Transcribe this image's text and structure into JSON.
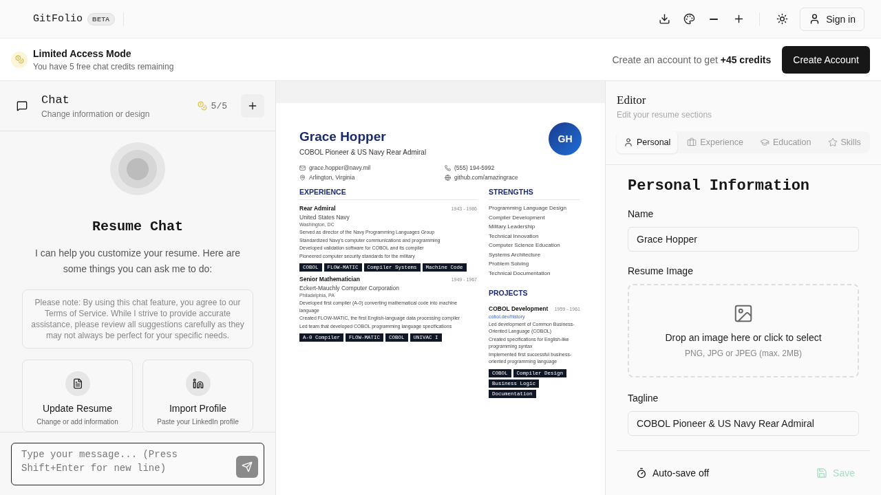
{
  "header": {
    "brand": "GitFolio",
    "badge": "BETA",
    "sign_in": "Sign in"
  },
  "banner": {
    "title": "Limited Access Mode",
    "subtitle": "You have 5 free chat credits remaining",
    "prompt": "Create an account to get **+45 credits**",
    "button": "Create Account"
  },
  "chat": {
    "title": "Chat",
    "subtitle": "Change information or design",
    "credits": "5/5",
    "heading": "Resume Chat",
    "intro": "I can help you customize your resume. Here are some things you can ask me to do:",
    "note": "Please note: By using this chat feature, you agree to our Terms of Service. While I strive to provide accurate assistance, please review all suggestions carefully as they may not always be perfect for your specific needs.",
    "actions": [
      {
        "kind": "document",
        "title": "Update Resume",
        "description": "Change or add information"
      },
      {
        "kind": "linkedin",
        "title": "Import Profile",
        "description": "Paste your LinkedIn profile"
      }
    ],
    "input": {
      "placeholder": "Type your message... (Press Shift+Enter for new line)"
    }
  },
  "resume": {
    "name": "Grace Hopper",
    "tagline": "COBOL Pioneer & US Navy Rear Admiral",
    "initials": "GH",
    "contacts": [
      {
        "kind": "email",
        "text": "grace.hopper@navy.mil"
      },
      {
        "kind": "phone",
        "text": "(555) 194-5992"
      },
      {
        "kind": "location",
        "text": "Arlington, Virginia"
      },
      {
        "kind": "web",
        "text": "github.com/amazingrace"
      }
    ],
    "experience": {
      "heading": "EXPERIENCE",
      "items": [
        {
          "title": "Rear Admiral",
          "dates": "1943 - 1986",
          "company": "United States Navy",
          "location": "Washington, DC",
          "bullets": [
            "Served as director of the Navy Programming Languages Group",
            "Standardized Navy's computer communications and programming",
            "Developed validation software for COBOL and its compiler",
            "Pioneered computer security standards for the military"
          ],
          "tags": [
            "COBOL",
            "FLOW-MATIC",
            "Compiler Systems",
            "Machine Code"
          ]
        },
        {
          "title": "Senior Mathematician",
          "dates": "1949 - 1967",
          "company": "Eckert-Mauchly Computer Corporation",
          "location": "Philadelphia, PA",
          "bullets": [
            "Developed first compiler (A-0) converting mathematical code into machine language",
            "Created FLOW-MATIC, the first English-language data processing compiler",
            "Led team that developed COBOL programming language specifications"
          ],
          "tags": [
            "A-0 Compiler",
            "FLOW-MATIC",
            "COBOL",
            "UNIVAC I"
          ]
        }
      ]
    },
    "strengths": {
      "heading": "STRENGTHS",
      "items": [
        "Programming Language Design",
        "Compiler Development",
        "Military Leadership",
        "Technical Innovation",
        "Computer Science Education",
        "Systems Architecture",
        "Problem Solving",
        "Technical Documentation"
      ]
    },
    "projects": {
      "heading": "PROJECTS",
      "items": [
        {
          "title": "COBOL Development",
          "dates": "1959 - 1961",
          "link": "cobol.dev/history",
          "bullets": [
            "Led development of Common Business-Oriented Language (COBOL)",
            "Created specifications for English-like programming syntax",
            "Implemented first successful business-oriented programming language"
          ],
          "tags": [
            "COBOL",
            "Compiler Design",
            "Business Logic",
            "Documentation"
          ]
        }
      ]
    }
  },
  "editor": {
    "title": "Editor",
    "subtitle": "Edit your resume sections",
    "tabs": [
      {
        "kind": "personal",
        "label": "Personal",
        "selected": true
      },
      {
        "kind": "experience",
        "label": "Experience",
        "selected": false
      },
      {
        "kind": "education",
        "label": "Education",
        "selected": false
      },
      {
        "kind": "skills",
        "label": "Skills",
        "selected": false
      }
    ],
    "section_title": "Personal Information",
    "name": {
      "label": "Name",
      "value": "Grace Hopper"
    },
    "image": {
      "label": "Resume Image",
      "drop_text": "Drop an image here or click to select",
      "hint": "PNG, JPG or JPEG (max. 2MB)"
    },
    "tagline": {
      "label": "Tagline",
      "value": "COBOL Pioneer & US Navy Rear Admiral"
    },
    "autosave": "Auto-save off",
    "save": {
      "label": "Save",
      "disabled": true
    }
  }
}
